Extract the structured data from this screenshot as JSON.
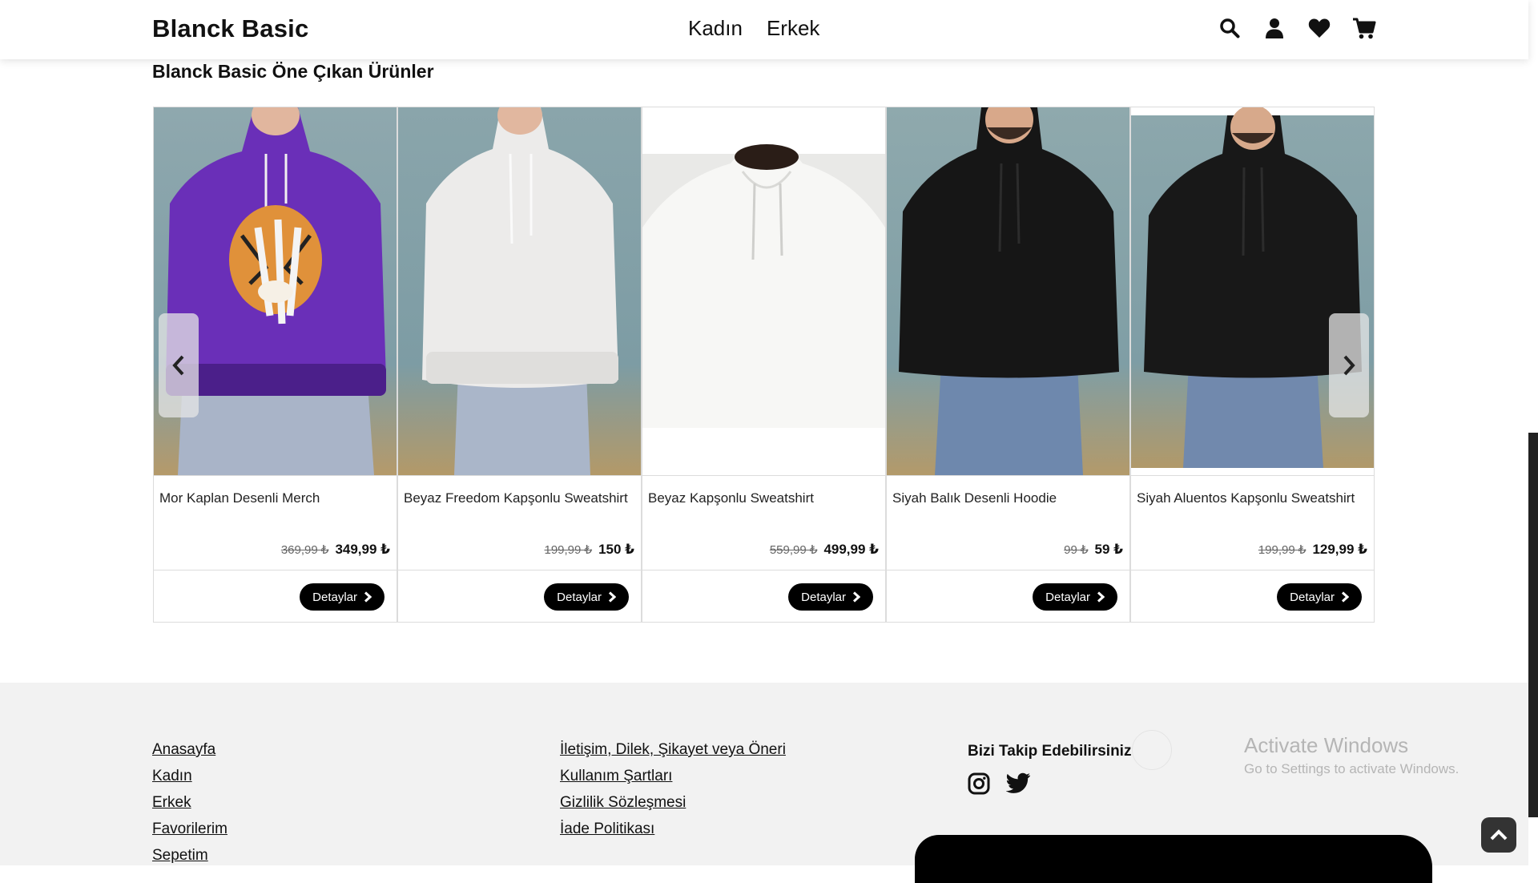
{
  "nav": {
    "brand": "Blanck Basic",
    "links": [
      "Kadın",
      "Erkek"
    ],
    "icons": [
      "search-icon",
      "user-icon",
      "heart-icon",
      "cart-icon"
    ]
  },
  "featured": {
    "title": "Blanck Basic Öne Çıkan Ürünler",
    "products": [
      {
        "name": "Mor Kaplan Desenli Merch",
        "old_price": "369,99 ₺",
        "price": "349,99 ₺",
        "button": "Detaylar",
        "color": "#6a2fb8"
      },
      {
        "name": "Beyaz Freedom Kapşonlu Sweatshirt",
        "old_price": "199,99 ₺",
        "price": "150 ₺",
        "button": "Detaylar",
        "color": "#f1f1ef"
      },
      {
        "name": "Beyaz Kapşonlu Sweatshirt",
        "old_price": "559,99 ₺",
        "price": "499,99 ₺",
        "button": "Detaylar",
        "color": "#f4f4f2"
      },
      {
        "name": "Siyah Balık Desenli Hoodie",
        "old_price": "99 ₺",
        "price": "59 ₺",
        "button": "Detaylar",
        "color": "#1a1a1a"
      },
      {
        "name": "Siyah Aluentos Kapşonlu Sweatshirt",
        "old_price": "199,99 ₺",
        "price": "129,99 ₺",
        "button": "Detaylar",
        "color": "#1c1c1c"
      }
    ]
  },
  "footer": {
    "col1": [
      "Anasayfa",
      "Kadın",
      "Erkek",
      "Favorilerim",
      "Sepetim"
    ],
    "col2": [
      "İletişim, Dilek, Şikayet veya Öneri",
      "Kullanım Şartları",
      "Gizlilik Sözleşmesi",
      "İade Politikası"
    ],
    "follow_title": "Bizi Takip Edebilirsiniz",
    "social": [
      "instagram-icon",
      "twitter-icon"
    ]
  },
  "watermark": {
    "line1": "Activate Windows",
    "line2": "Go to Settings to activate Windows."
  }
}
